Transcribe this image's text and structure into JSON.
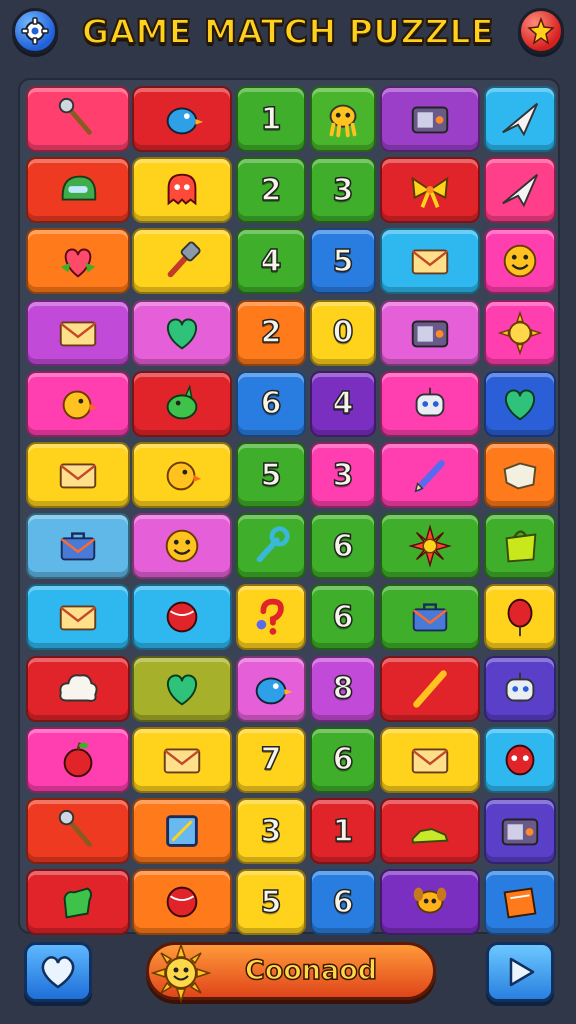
{
  "header": {
    "title": "GAME MATCH PUZZLE",
    "settings_icon": "gear-icon",
    "alert_icon": "star-alert-icon"
  },
  "board": {
    "rows": 12,
    "cols": 6,
    "tiles": [
      [
        {
          "color": "#ff3f6e",
          "icon": "wand"
        },
        {
          "color": "#e0242a",
          "icon": "bird"
        },
        {
          "color": "#3fae2a",
          "text": "1"
        },
        {
          "color": "#49b52c",
          "icon": "octopus"
        },
        {
          "color": "#9c3fc8",
          "icon": "radio"
        },
        {
          "color": "#2fb8ef",
          "icon": "paper-plane"
        }
      ],
      [
        {
          "color": "#ee3a20",
          "icon": "helmet"
        },
        {
          "color": "#ffd21c",
          "icon": "ghost"
        },
        {
          "color": "#3fae2a",
          "text": "2"
        },
        {
          "color": "#3fae2a",
          "text": "3"
        },
        {
          "color": "#e0242a",
          "icon": "bow"
        },
        {
          "color": "#ff3f8a",
          "icon": "paper-plane"
        }
      ],
      [
        {
          "color": "#ff7a1a",
          "icon": "heart-flower"
        },
        {
          "color": "#ffd21c",
          "icon": "hammer"
        },
        {
          "color": "#3fae2a",
          "text": "4"
        },
        {
          "color": "#2a7de0",
          "text": "5"
        },
        {
          "color": "#2fb8ef",
          "icon": "envelope"
        },
        {
          "color": "#ff3fb0",
          "icon": "smiley"
        }
      ],
      [
        {
          "color": "#c24ad8",
          "icon": "envelope"
        },
        {
          "color": "#e560d8",
          "icon": "heart"
        },
        {
          "color": "#ff7a1a",
          "text": "2"
        },
        {
          "color": "#ffd21c",
          "text": "0"
        },
        {
          "color": "#e560d8",
          "icon": "radio"
        },
        {
          "color": "#ff3fb0",
          "icon": "sun"
        }
      ],
      [
        {
          "color": "#ff3fb0",
          "icon": "chick"
        },
        {
          "color": "#e0242a",
          "icon": "dragon"
        },
        {
          "color": "#2a7de0",
          "text": "6"
        },
        {
          "color": "#7a2fc0",
          "text": "4"
        },
        {
          "color": "#ff3fb0",
          "icon": "robot"
        },
        {
          "color": "#2a5fd8",
          "icon": "heart"
        }
      ],
      [
        {
          "color": "#ffd21c",
          "icon": "envelope"
        },
        {
          "color": "#ffd21c",
          "icon": "chick"
        },
        {
          "color": "#3fae2a",
          "text": "5"
        },
        {
          "color": "#ff3fb0",
          "text": "3"
        },
        {
          "color": "#ff3fb0",
          "icon": "pencil"
        },
        {
          "color": "#ff7a1a",
          "icon": "cloth"
        }
      ],
      [
        {
          "color": "#5fb8e8",
          "icon": "briefcase"
        },
        {
          "color": "#e560d8",
          "icon": "smiley"
        },
        {
          "color": "#3fae2a",
          "icon": "wrench"
        },
        {
          "color": "#3fae2a",
          "text": "6"
        },
        {
          "color": "#3fae2a",
          "icon": "flower"
        },
        {
          "color": "#3fae2a",
          "icon": "bag"
        }
      ],
      [
        {
          "color": "#2fb8ef",
          "icon": "envelope"
        },
        {
          "color": "#2fb8ef",
          "icon": "ball"
        },
        {
          "color": "#ffd21c",
          "icon": "question"
        },
        {
          "color": "#3fae2a",
          "text": "6"
        },
        {
          "color": "#3fae2a",
          "icon": "briefcase"
        },
        {
          "color": "#ffd21c",
          "icon": "balloon"
        }
      ],
      [
        {
          "color": "#e0242a",
          "icon": "cloud"
        },
        {
          "color": "#a6b02a",
          "icon": "heart"
        },
        {
          "color": "#e560d8",
          "icon": "bird"
        },
        {
          "color": "#c24ad8",
          "text": "8"
        },
        {
          "color": "#e0242a",
          "icon": "stick"
        },
        {
          "color": "#5a3fc8",
          "icon": "robot"
        }
      ],
      [
        {
          "color": "#ff3fb0",
          "icon": "apple"
        },
        {
          "color": "#ffd21c",
          "icon": "envelope"
        },
        {
          "color": "#ffd21c",
          "text": "7"
        },
        {
          "color": "#3fae2a",
          "text": "6"
        },
        {
          "color": "#ffd21c",
          "icon": "envelope"
        },
        {
          "color": "#2fb8ef",
          "icon": "mask"
        }
      ],
      [
        {
          "color": "#ee3a20",
          "icon": "wand"
        },
        {
          "color": "#ff7a1a",
          "icon": "frame"
        },
        {
          "color": "#ffd21c",
          "text": "3"
        },
        {
          "color": "#e0242a",
          "text": "1"
        },
        {
          "color": "#e0242a",
          "icon": "shoe"
        },
        {
          "color": "#5a3fc8",
          "icon": "radio"
        }
      ],
      [
        {
          "color": "#e0242a",
          "icon": "glove"
        },
        {
          "color": "#ff7a1a",
          "icon": "ball"
        },
        {
          "color": "#ffd21c",
          "text": "5"
        },
        {
          "color": "#2a7de0",
          "text": "6"
        },
        {
          "color": "#7a2fc0",
          "icon": "dog"
        },
        {
          "color": "#2a7de0",
          "icon": "book"
        }
      ]
    ]
  },
  "footer": {
    "heart_icon": "heart-icon",
    "action_label": "Coonaod",
    "sun_icon": "sun-icon",
    "play_icon": "play-icon"
  }
}
